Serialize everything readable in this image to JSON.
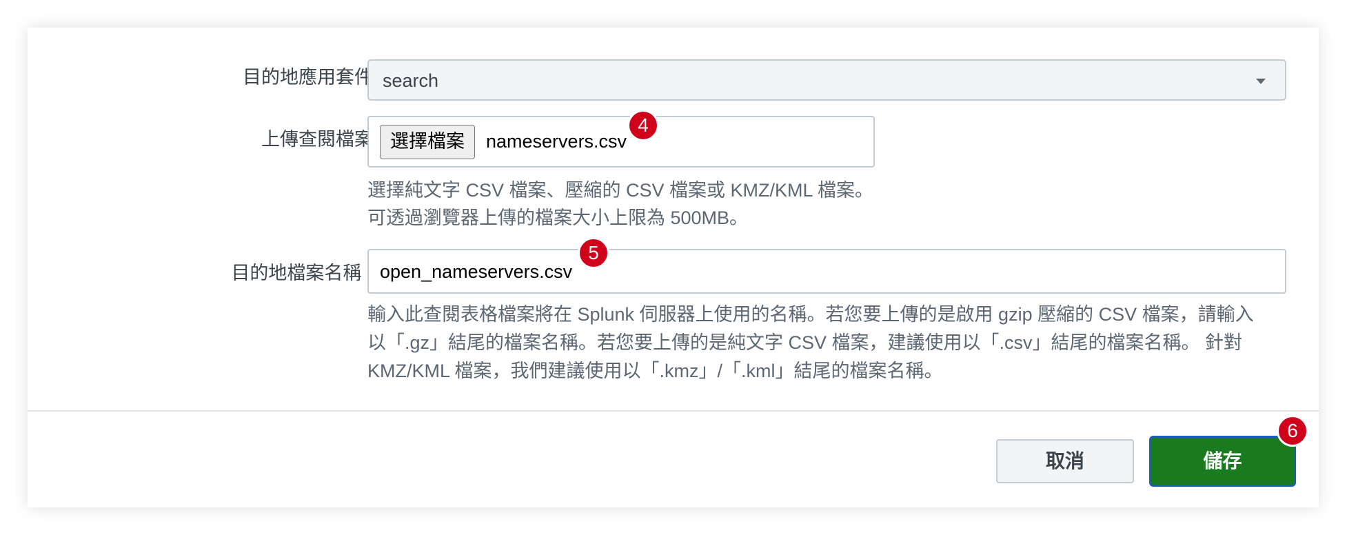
{
  "form": {
    "dest_app": {
      "label": "目的地應用套件",
      "value": "search"
    },
    "upload": {
      "label": "上傳查閱檔案",
      "button_label": "選擇檔案",
      "file_name": "nameservers.csv",
      "help_line1": "選擇純文字 CSV 檔案、壓縮的 CSV 檔案或 KMZ/KML 檔案。",
      "help_line2": "可透過瀏覽器上傳的檔案大小上限為 500MB。"
    },
    "dest_filename": {
      "label": "目的地檔案名稱",
      "required_mark": "*",
      "value": "open_nameservers.csv",
      "help_line1": "輸入此查閱表格檔案將在 Splunk 伺服器上使用的名稱。若您要上傳的是啟用 gzip 壓縮的 CSV 檔案，請輸入",
      "help_line2": "以「.gz」結尾的檔案名稱。若您要上傳的是純文字 CSV 檔案，建議使用以「.csv」結尾的檔案名稱。 針對",
      "help_line3": "KMZ/KML 檔案，我們建議使用以「.kmz」/「.kml」結尾的檔案名稱。"
    }
  },
  "footer": {
    "cancel_label": "取消",
    "save_label": "儲存"
  },
  "badges": {
    "badge_4": "4",
    "badge_5": "5",
    "badge_6": "6"
  },
  "colors": {
    "save_button": "#1a7a1f",
    "save_border": "#1a5fb4",
    "badge": "#d0021b",
    "required": "#dc4e41"
  },
  "icons": {
    "dropdown": "caret-down-icon"
  }
}
